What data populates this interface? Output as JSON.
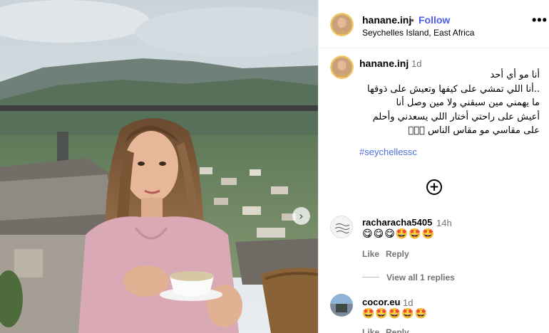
{
  "post": {
    "image_alt": "Woman holding a coffee cup on a balcony with mountains and town behind",
    "next_icon": "chevron-right-icon"
  },
  "header": {
    "username": "hanane.inj",
    "separator": "•",
    "follow_label": "Follow",
    "location": "Seychelles Island, East Africa",
    "more_icon": "•••"
  },
  "caption": {
    "username": "hanane.inj",
    "time": "1d",
    "text": "أنا مو أي أحد\n..أنا اللي تمشي على كيفها وتعيش على ذوقها\nما يهمني مين سبقني ولا مين وصل أنا\nأعيش على راحتي أختار اللي يسعدني وأحلم\nعلى مقاسي مو مقاس الناس 🏻🏻🏻",
    "hashtag": "#seychellessc"
  },
  "actions": {
    "add_comment_icon": "+"
  },
  "comments": [
    {
      "username": "racharacha5405",
      "time": "14h",
      "text": "😋😋😋🤩🤩🤩",
      "like": "Like",
      "reply": "Reply",
      "view_replies": "View all 1 replies"
    },
    {
      "username": "cocor.eu",
      "time": "1d",
      "text": "🤩🤩🤩🤩🤩",
      "like": "Like",
      "reply": "Reply"
    }
  ],
  "colors": {
    "follow": "#4a5de8",
    "hashtag": "#4a6fd8",
    "muted": "#737373"
  }
}
